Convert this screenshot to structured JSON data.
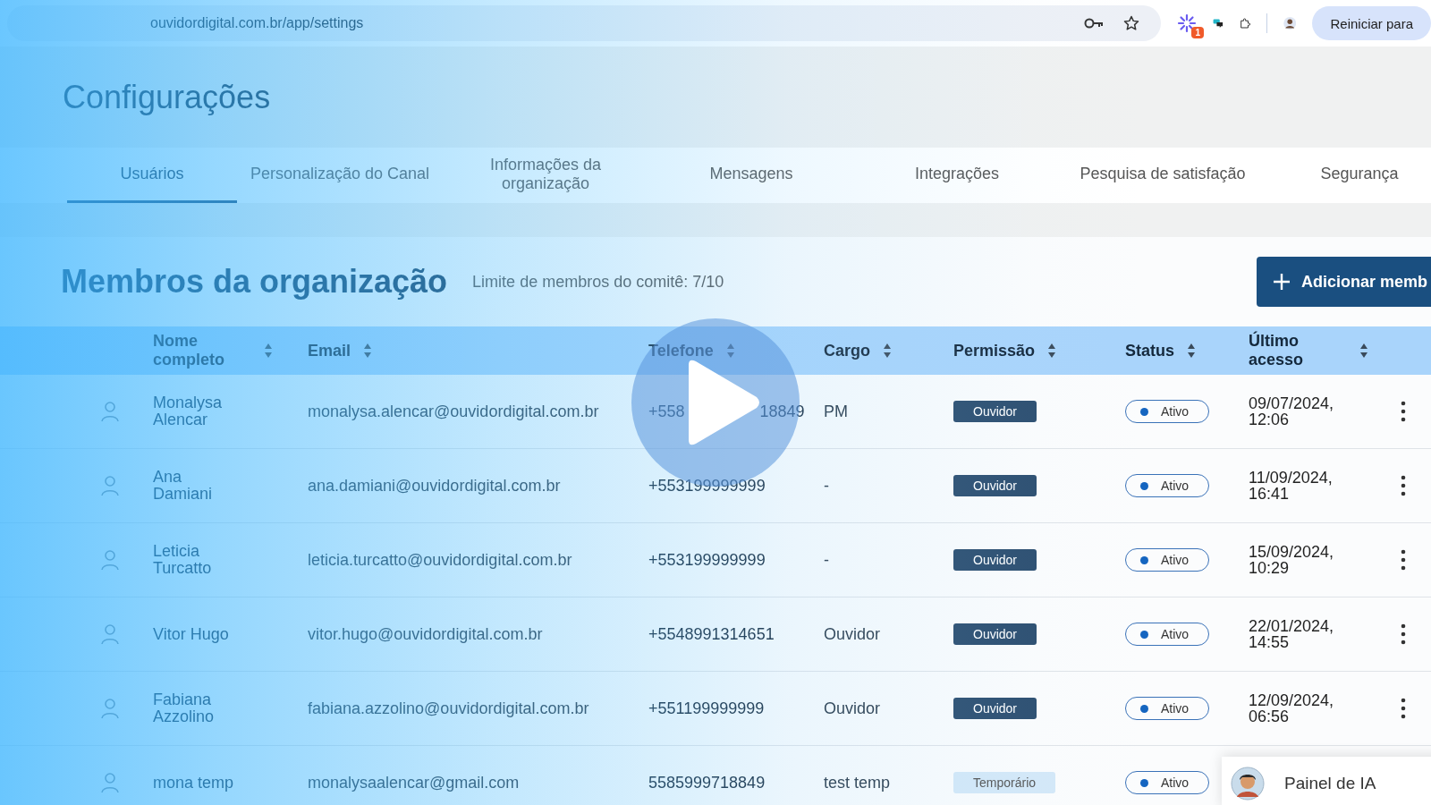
{
  "browser": {
    "url": "ouvidordigital.com.br/app/settings",
    "extension_badge": "1",
    "restart_button": "Reiniciar para"
  },
  "page_title": "Configurações",
  "tabs": [
    {
      "label": "Usuários",
      "selected": true
    },
    {
      "label": "Personalização do Canal",
      "selected": false
    },
    {
      "label": "Informações da organização",
      "selected": false
    },
    {
      "label": "Mensagens",
      "selected": false
    },
    {
      "label": "Integrações",
      "selected": false
    },
    {
      "label": "Pesquisa de satisfação",
      "selected": false
    },
    {
      "label": "Segurança",
      "selected": false
    }
  ],
  "section": {
    "title": "Membros da organização",
    "limit": "Limite de membros do comitê: 7/10",
    "add_button": "Adicionar memb"
  },
  "table": {
    "columns": [
      "Nome completo",
      "Email",
      "Telefone",
      "Cargo",
      "Permissão",
      "Status",
      "Último acesso"
    ],
    "rows": [
      {
        "name": "Monalysa Alencar",
        "email": "monalysa.alencar@ouvidordigital.com.br",
        "phone": [
          "+558",
          "18849"
        ],
        "role": "PM",
        "permission": {
          "label": "Ouvidor",
          "kind": "role"
        },
        "status": "Ativo",
        "last_access": "09/07/2024, 12:06"
      },
      {
        "name": "Ana Damiani",
        "email": "ana.damiani@ouvidordigital.com.br",
        "phone": [
          "+553199999999"
        ],
        "role": "-",
        "permission": {
          "label": "Ouvidor",
          "kind": "role"
        },
        "status": "Ativo",
        "last_access": "11/09/2024, 16:41"
      },
      {
        "name": "Leticia Turcatto",
        "email": "leticia.turcatto@ouvidordigital.com.br",
        "phone": [
          "+553199999999"
        ],
        "role": "-",
        "permission": {
          "label": "Ouvidor",
          "kind": "role"
        },
        "status": "Ativo",
        "last_access": "15/09/2024, 10:29"
      },
      {
        "name": "Vitor Hugo",
        "email": "vitor.hugo@ouvidordigital.com.br",
        "phone": [
          "+5548991314651"
        ],
        "role": "Ouvidor",
        "permission": {
          "label": "Ouvidor",
          "kind": "role"
        },
        "status": "Ativo",
        "last_access": "22/01/2024, 14:55"
      },
      {
        "name": "Fabiana Azzolino",
        "email": "fabiana.azzolino@ouvidordigital.com.br",
        "phone": [
          "+551199999999"
        ],
        "role": "Ouvidor",
        "permission": {
          "label": "Ouvidor",
          "kind": "role"
        },
        "status": "Ativo",
        "last_access": "12/09/2024, 06:56"
      },
      {
        "name": "mona temp",
        "email": "monalysaalencar@gmail.com",
        "phone": [
          "5585999718849"
        ],
        "role": "test temp",
        "permission": {
          "label": "Temporário",
          "kind": "temporary"
        },
        "status": "Ativo"
      }
    ]
  },
  "ai_panel": {
    "label": "Painel de IA"
  }
}
